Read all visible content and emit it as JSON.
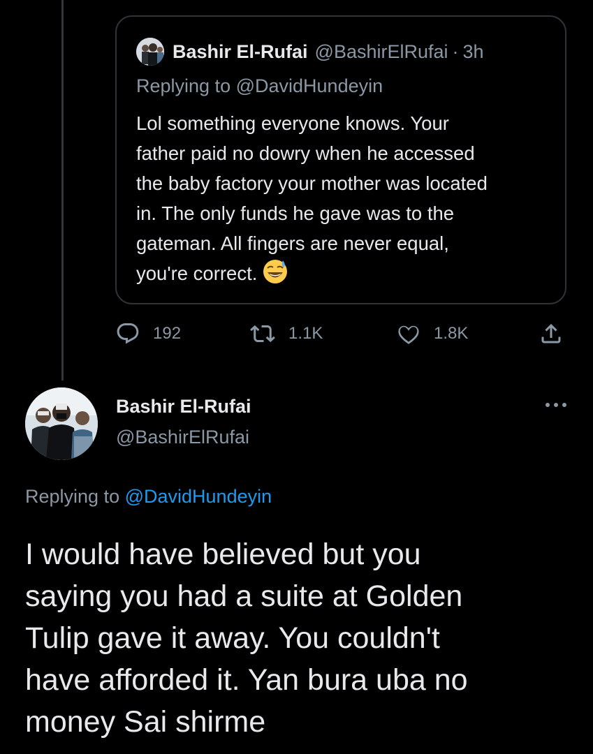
{
  "quoted_tweet": {
    "author_name": "Bashir El-Rufai",
    "author_handle": "@BashirElRufai",
    "separator": "·",
    "time": "3h",
    "replying_prefix": "Replying to ",
    "replying_handle": "@DavidHundeyin",
    "body_lines": [
      "Lol something everyone knows. Your",
      "father paid no dowry when he accessed",
      "the baby factory your mother was located",
      "in. The only funds he gave was to the",
      "gateman. All fingers are never equal,",
      "you're correct."
    ],
    "emoji_icon": "grinning-face-with-sweat-emoji"
  },
  "actions": {
    "reply_count": "192",
    "retweet_count": "1.1K",
    "like_count": "1.8K",
    "icons": [
      "reply-icon",
      "retweet-icon",
      "like-icon",
      "share-icon"
    ]
  },
  "main_tweet": {
    "author_name": "Bashir El-Rufai",
    "author_handle": "@BashirElRufai",
    "replying_prefix": "Replying to ",
    "replying_handle": "@DavidHundeyin",
    "body_lines": [
      "I would have believed but you",
      "saying you had a suite at Golden",
      "Tulip gave it away. You couldn't",
      "have afforded it. Yan bura uba no",
      "money Sai shirme"
    ],
    "more_icon": "more-options-icon"
  },
  "colors": {
    "background": "#000000",
    "primary_text": "#e7e9ea",
    "secondary_text": "#8b98a5",
    "link": "#1d9bf0",
    "border": "#2f3336"
  }
}
